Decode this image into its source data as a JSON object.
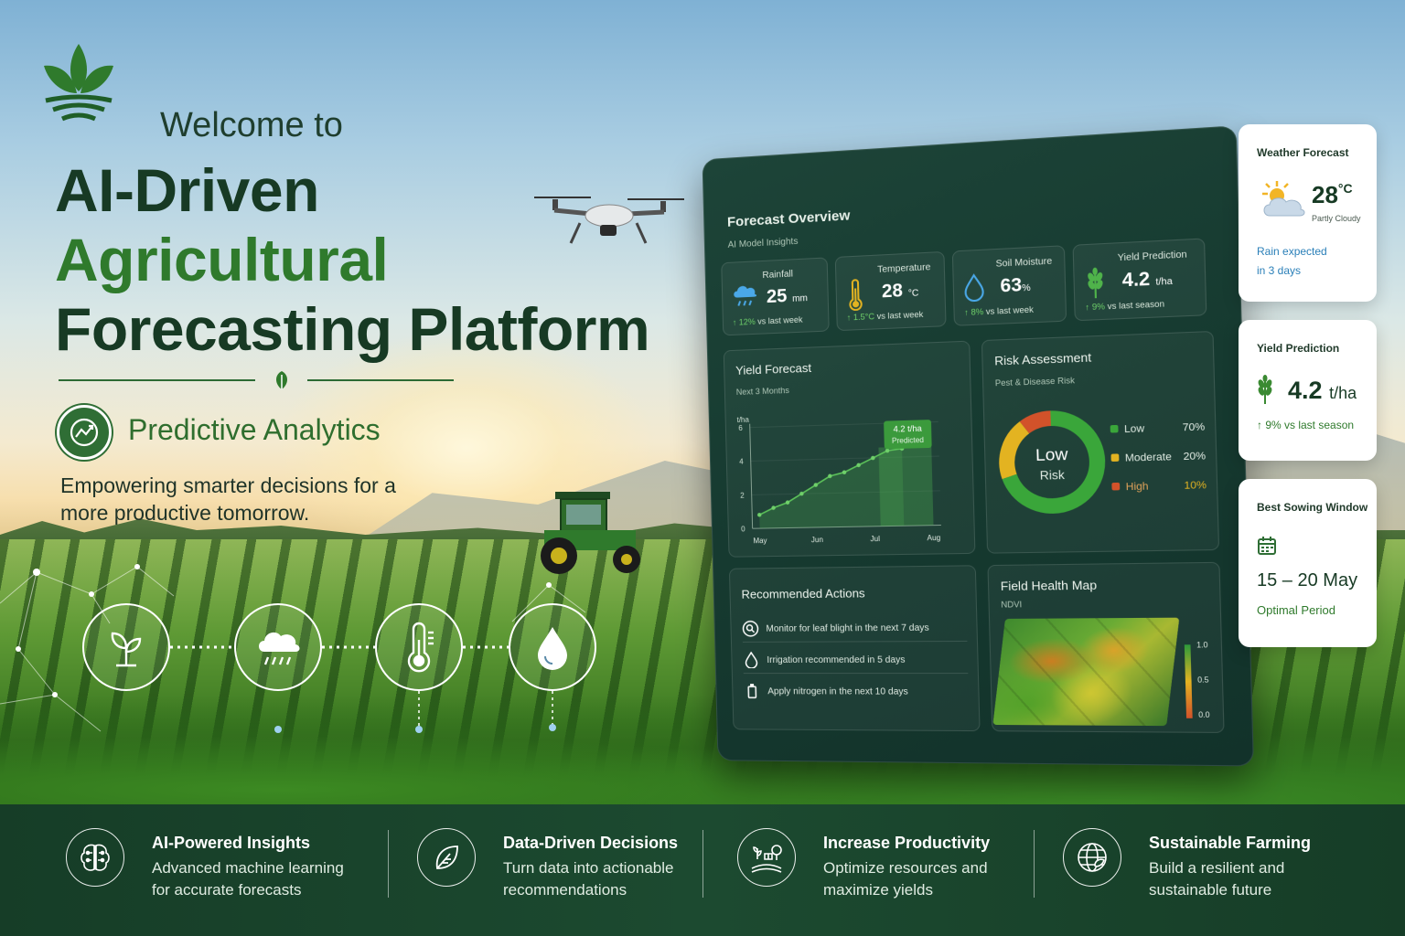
{
  "hero": {
    "welcome": "Welcome to",
    "title_line1": "AI-Driven",
    "title_line2": "Agricultural",
    "title_line3": "Forecasting Platform",
    "badge_label": "Predictive Analytics",
    "tagline": "Empowering smarter decisions for a more productive tomorrow."
  },
  "dashboard": {
    "title": "Forecast Overview",
    "subtitle": "AI Model Insights",
    "stats": [
      {
        "label": "Rainfall",
        "value": "25",
        "unit": "mm",
        "change_arrow": "↑ 12%",
        "change_text": "vs last week"
      },
      {
        "label": "Temperature",
        "value": "28",
        "unit": "°C",
        "change_arrow": "↑ 1.5°C",
        "change_text": "vs last week"
      },
      {
        "label": "Soil Moisture",
        "value": "63",
        "unit": "%",
        "change_arrow": "↑ 8%",
        "change_text": "vs last week"
      },
      {
        "label": "Yield Prediction",
        "value": "4.2",
        "unit": "t/ha",
        "change_arrow": "↑ 9%",
        "change_text": "vs last season"
      }
    ],
    "yield_forecast": {
      "title": "Yield Forecast",
      "subtitle": "Next 3 Months",
      "unit_label": "t/ha",
      "callout_value": "4.2 t/ha",
      "callout_label": "Predicted"
    },
    "risk": {
      "title": "Risk Assessment",
      "subtitle": "Pest & Disease Risk",
      "center_line1": "Low",
      "center_line2": "Risk",
      "items": [
        {
          "label": "Low",
          "pct": "70%",
          "color": "#3aa63a"
        },
        {
          "label": "Moderate",
          "pct": "20%",
          "color": "#e3b321"
        },
        {
          "label": "High",
          "pct": "10%",
          "color": "#d2522a"
        }
      ]
    },
    "actions": {
      "title": "Recommended Actions",
      "items": [
        "Monitor for leaf blight in the next 7 days",
        "Irrigation recommended in 5 days",
        "Apply nitrogen in the next 10 days"
      ]
    },
    "field_map": {
      "title": "Field Health Map",
      "subtitle": "NDVI",
      "scale": [
        "1.0",
        "0.5",
        "0.0"
      ]
    }
  },
  "chart_data": {
    "type": "area",
    "title": "Yield Forecast",
    "subtitle": "Next 3 Months",
    "ylabel": "t/ha",
    "xlabel": "",
    "categories": [
      "May",
      "Jun",
      "Jul",
      "Aug"
    ],
    "y_ticks": [
      0,
      2,
      4,
      6
    ],
    "ylim": [
      0,
      6
    ],
    "x": [
      0,
      0.25,
      0.5,
      0.75,
      1.0,
      1.25,
      1.5,
      1.75,
      2.0,
      2.25,
      2.5
    ],
    "values": [
      0.8,
      1.2,
      1.5,
      2.0,
      2.5,
      3.0,
      3.2,
      3.6,
      4.0,
      4.4,
      4.5
    ],
    "legend": "none",
    "grid": true
  },
  "widgets": {
    "weather": {
      "title": "Weather Forecast",
      "temp": "28",
      "unit": "°C",
      "condition": "Partly Cloudy",
      "note_line1": "Rain expected",
      "note_line2": "in 3 days"
    },
    "yield": {
      "title": "Yield Prediction",
      "value": "4.2",
      "unit": "t/ha",
      "change": "↑ 9% vs last season"
    },
    "sowing": {
      "title": "Best Sowing Window",
      "dates": "15 – 20 May",
      "note": "Optimal Period"
    }
  },
  "footer": [
    {
      "title": "AI-Powered Insights",
      "desc": "Advanced machine learning for accurate forecasts",
      "icon": "brain-icon"
    },
    {
      "title": "Data-Driven Decisions",
      "desc": "Turn data into actionable recommendations",
      "icon": "leaf-icon"
    },
    {
      "title": "Increase Productivity",
      "desc": "Optimize resources and maximize yields",
      "icon": "crops-icon"
    },
    {
      "title": "Sustainable Farming",
      "desc": "Build a resilient and sustainable future",
      "icon": "globe-icon"
    }
  ],
  "colors": {
    "brand_green": "#2f7a2c",
    "dark_green": "#173a24",
    "panel": "#163a30"
  }
}
